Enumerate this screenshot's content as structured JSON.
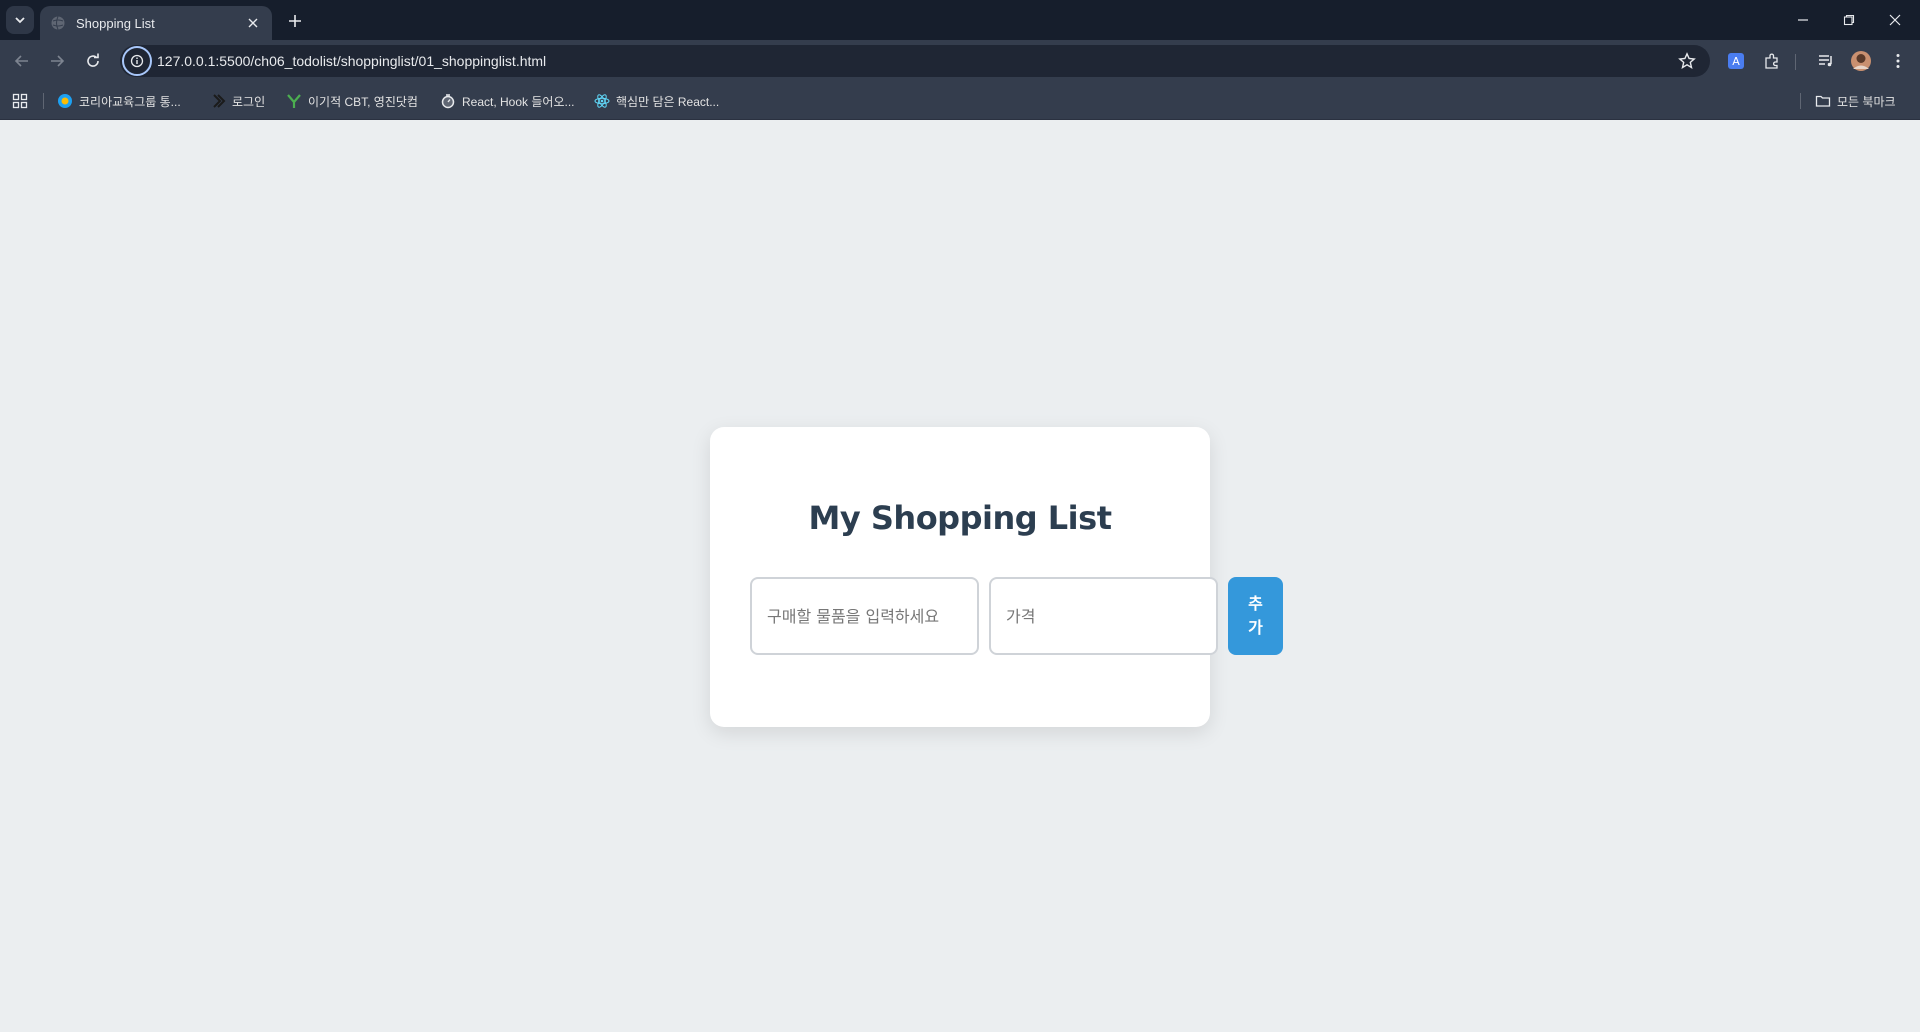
{
  "browser": {
    "tab": {
      "title": "Shopping List"
    },
    "address": {
      "url": "127.0.0.1:5500/ch06_todolist/shoppinglist/01_shoppinglist.html"
    },
    "bookmarks": [
      {
        "label": "코리아교육그룹 통...",
        "icon": "circle-logo-icon"
      },
      {
        "label": "로그인",
        "icon": "logo-icon"
      },
      {
        "label": "이기적 CBT, 영진닷컴",
        "icon": "y-logo-icon"
      },
      {
        "label": "React, Hook 들어오...",
        "icon": "stopwatch-icon"
      },
      {
        "label": "핵심만 담은 React...",
        "icon": "react-icon"
      }
    ],
    "all_bookmarks_label": "모든 북마크"
  },
  "page": {
    "title": "My Shopping List",
    "item_input": {
      "placeholder": "구매할 물품을 입력하세요",
      "value": ""
    },
    "price_input": {
      "placeholder": "가격",
      "value": ""
    },
    "add_button_label": "추가"
  },
  "colors": {
    "accent": "#3498db",
    "title_text": "#2c3e50",
    "page_background": "#ebeef0",
    "card_background": "#ffffff"
  }
}
